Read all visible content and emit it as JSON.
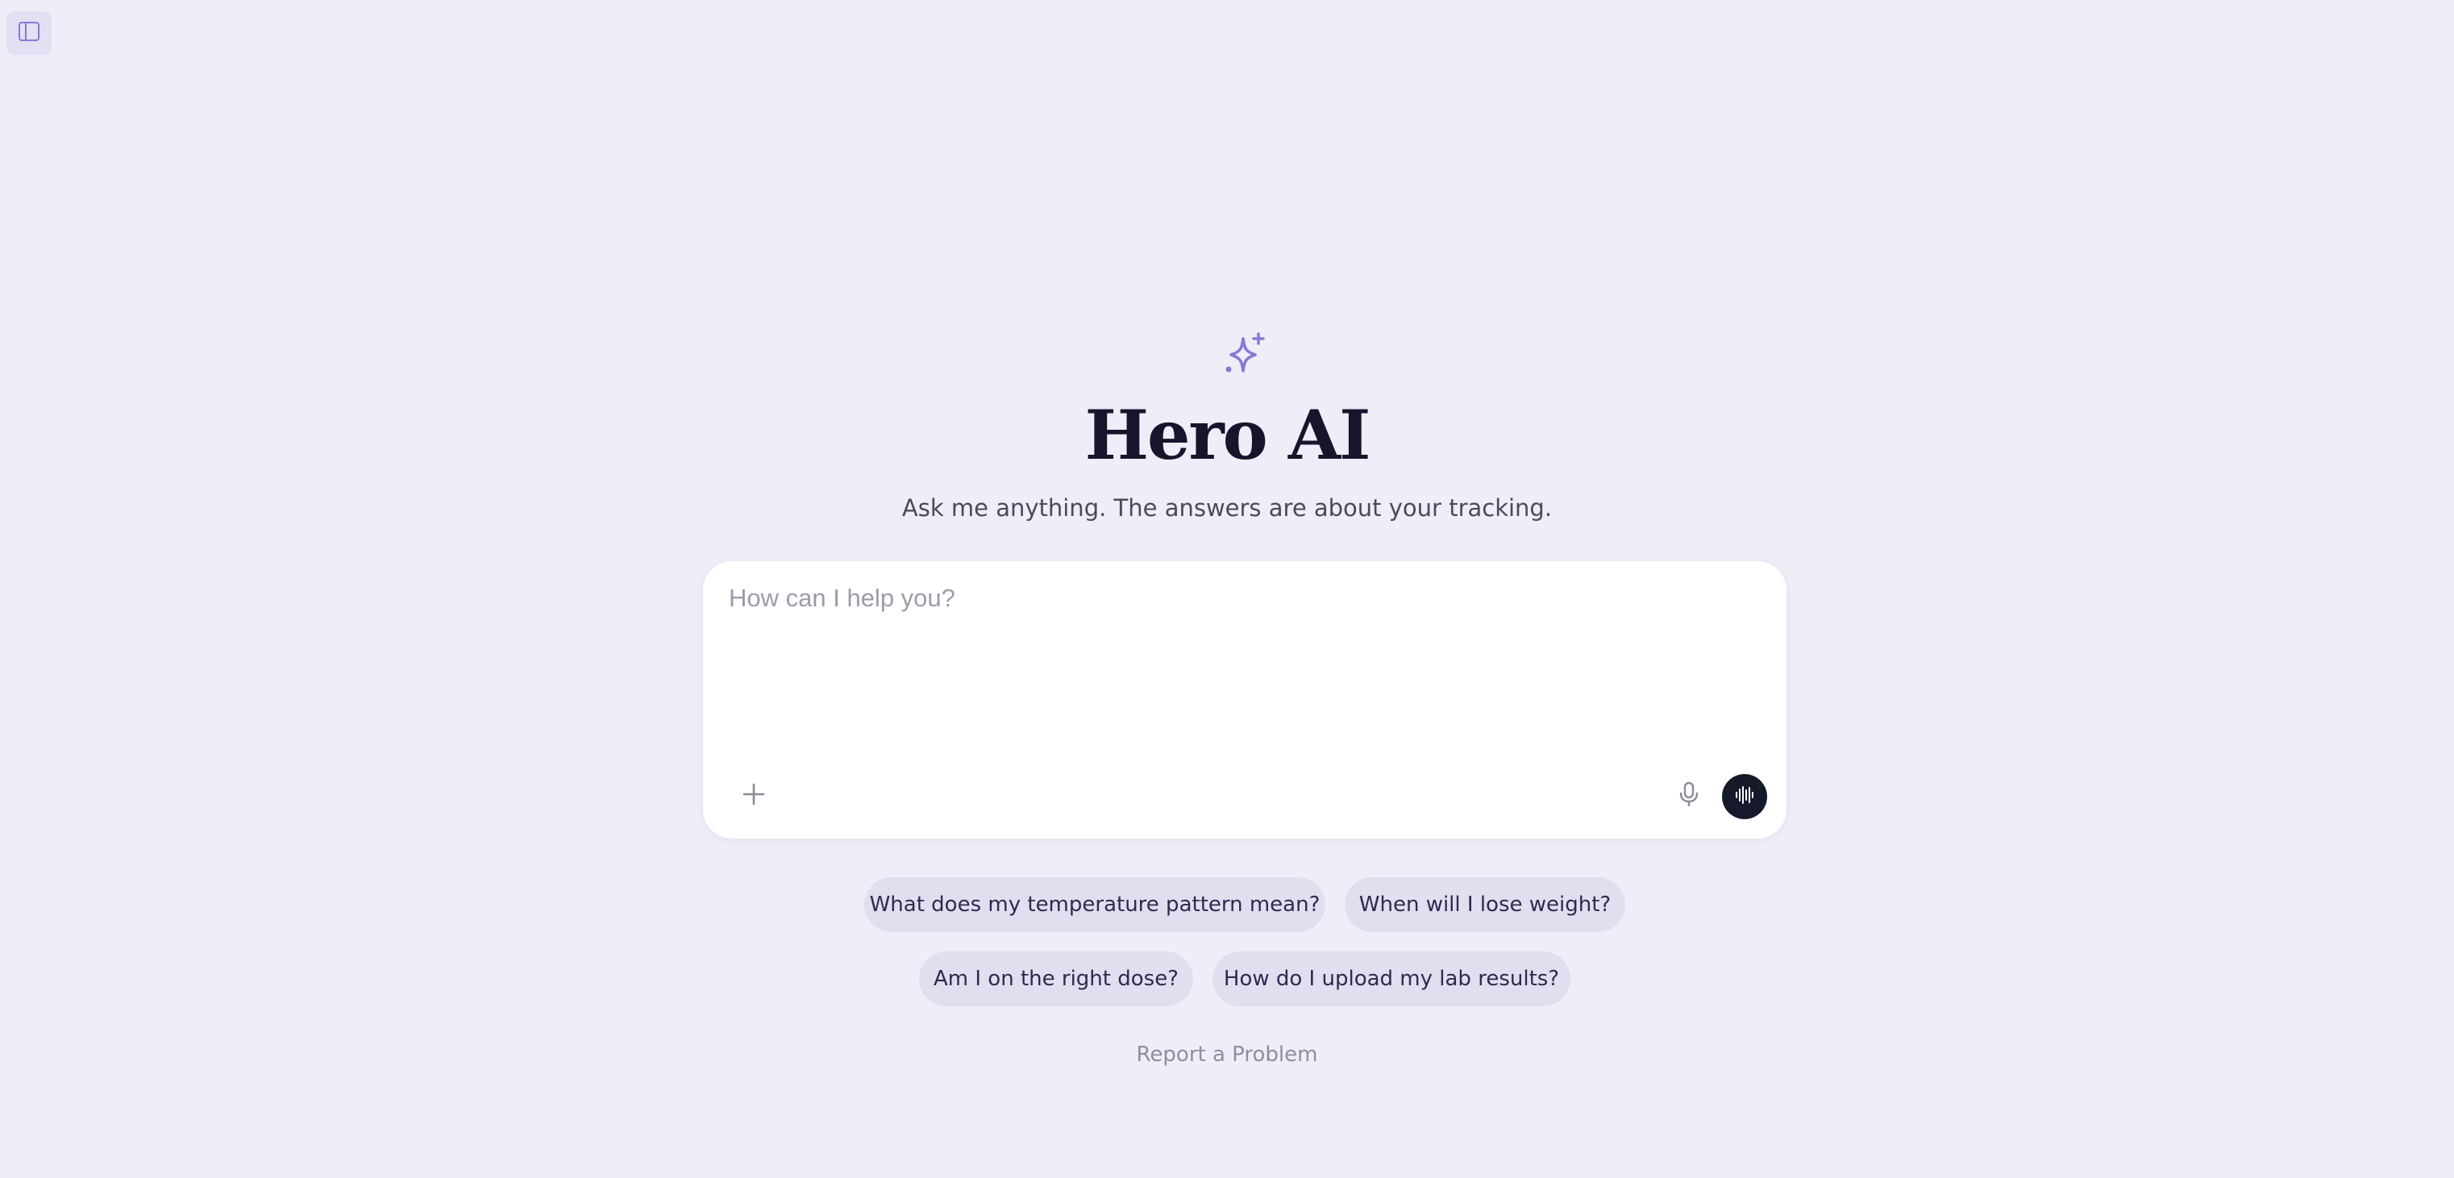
{
  "hero": {
    "title": "Hero AI",
    "subtitle": "Ask me anything. The answers are about your tracking.",
    "icon": "sparkle-icon"
  },
  "composer": {
    "placeholder": "How can I help you?",
    "value": "",
    "attach_icon": "plus-icon",
    "mic_icon": "microphone-icon",
    "voice_icon": "audio-waveform-icon"
  },
  "suggestions": [
    "What does my temperature pattern mean?",
    "When will I lose weight?",
    "Am I on the right dose?",
    "How do I upload my lab results?"
  ],
  "footer": {
    "report_label": "Report a Problem"
  },
  "colors": {
    "background": "#f0edf8",
    "accent": "#8a78d4",
    "chip_background": "#e2ddef",
    "voice_button": "#151a2b"
  }
}
